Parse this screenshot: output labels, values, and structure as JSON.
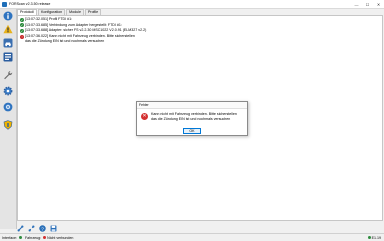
{
  "window": {
    "title": "FORScan v2.3.50 release",
    "minimize": "—",
    "maximize": "☐",
    "close": "✕"
  },
  "tabs": [
    {
      "label": "Protokoll"
    },
    {
      "label": "Konfiguration"
    },
    {
      "label": "Module"
    },
    {
      "label": "Profile"
    }
  ],
  "log": {
    "line1": "[13:07:32.051] Profil FTDI #1:",
    "line2": "[13:07:33.685] Verbindung zum Adapter hergestellt: FTDI #1:",
    "line3": "[13:07:33.688] Adapter:  sicher FS v2.2.30 MSC1022 V2.0.91 (ELM327 v2.2)",
    "line4": "[13:07:36.022] Kann nicht mit Fahrzeug verbinden. Bitte sicherstellen",
    "line4_cont": "das die Zündung EIN ist und nochmals versuchen"
  },
  "dialog": {
    "title": "Fehler",
    "message_line1": "Kann nicht mit Fahrzeug verbinden. Bitte sicherstellen",
    "message_line2": "das die Zündung EIN ist und nochmals versuchen",
    "ok_label": "OK"
  },
  "status": {
    "interface_label": "Interface:",
    "vehicle_label": "Fahrzeug:",
    "not_connected": "Nicht verbunden",
    "version": "E1.19"
  },
  "colors": {
    "accent": "#1f6fb8",
    "ok": "#2e8b3e",
    "error": "#c62828"
  },
  "icons": {
    "sidebar": [
      "info-icon",
      "warning-icon",
      "vehicle-icon",
      "dashboard-icon",
      "wrench-icon",
      "gear-icon",
      "settings-icon",
      "shield-icon"
    ],
    "toolbar": [
      "link-icon",
      "unlink-icon",
      "help-icon",
      "save-icon"
    ]
  }
}
